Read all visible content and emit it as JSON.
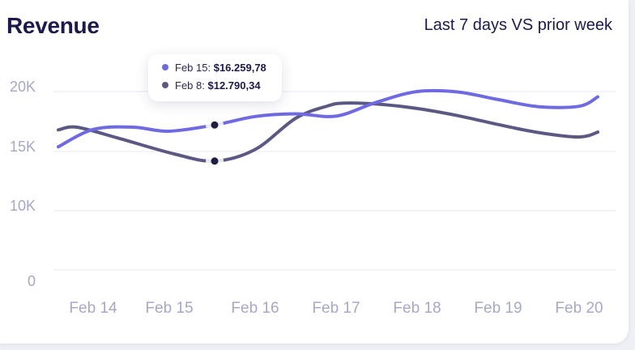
{
  "colors": {
    "current": "#6f6ae2",
    "prior": "#5b5982",
    "grid": "#ececf3",
    "marker": "#1f1e44"
  },
  "chart_data": {
    "type": "line",
    "title": "Revenue",
    "subtitle": "Last 7 days VS prior week",
    "categories": [
      "Feb 14",
      "Feb 15",
      "Feb 16",
      "Feb 17",
      "Feb 18",
      "Feb 19",
      "Feb 20"
    ],
    "y_ticks": [
      "20K",
      "15K",
      "10K",
      "0"
    ],
    "ylim": [
      0,
      20000
    ],
    "grid": true,
    "series": [
      {
        "key": "current",
        "x": [
          13.57,
          14.0,
          14.5,
          14.93,
          15.5,
          16.0,
          16.5,
          17.0,
          17.5,
          18.0,
          18.5,
          19.0,
          19.5,
          20.0,
          20.23
        ],
        "y": [
          13800,
          15750,
          16000,
          15550,
          16250,
          17200,
          17500,
          17250,
          18800,
          20000,
          19950,
          19100,
          18300,
          18350,
          19400
        ]
      },
      {
        "key": "prior",
        "x": [
          13.57,
          13.8,
          14.3,
          15.0,
          15.5,
          16.0,
          16.5,
          16.9,
          17.1,
          17.5,
          18.0,
          18.5,
          19.0,
          19.5,
          20.0,
          20.23
        ],
        "y": [
          15700,
          16000,
          14800,
          13000,
          12200,
          13500,
          17000,
          18400,
          18700,
          18600,
          18100,
          17300,
          16300,
          15400,
          14900,
          15450
        ]
      }
    ],
    "tooltip": {
      "rows": [
        {
          "series": "current",
          "label": "Feb 15:",
          "value": "$16.259,78"
        },
        {
          "series": "prior",
          "label": "Feb 8:",
          "value": "$12.790,34"
        }
      ]
    }
  }
}
